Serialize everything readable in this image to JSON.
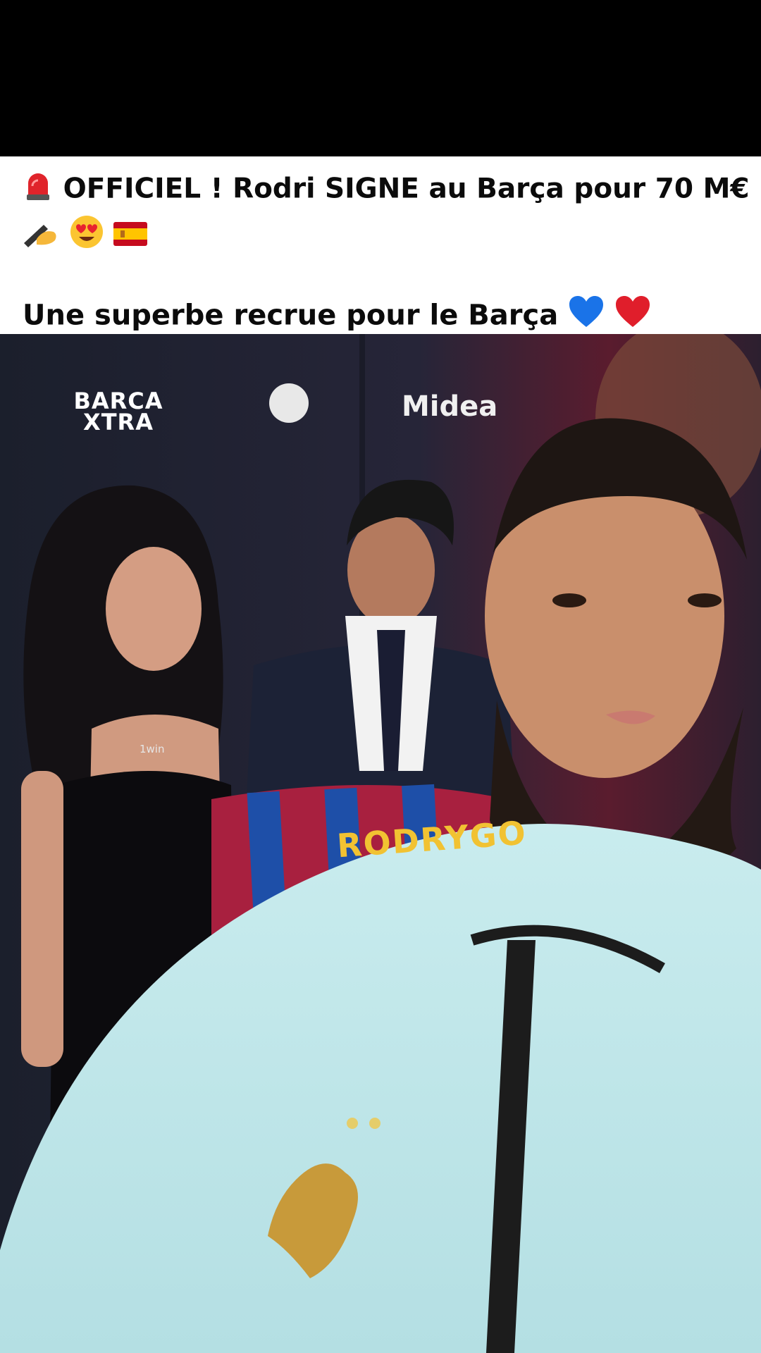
{
  "caption": {
    "headline": "OFFICIEL ! Rodri SIGNE au Barça pour 70 M€ !",
    "subline": "Une superbe recrue pour le Barça",
    "icons": [
      "police-light-emoji",
      "writing-hand-emoji",
      "heart-eyes-emoji",
      "spain-flag-emoji",
      "blue-heart-emoji",
      "red-heart-emoji"
    ]
  },
  "media": {
    "barca_logo": "BARCA\nXTRA",
    "midea_logo": "Midea",
    "jersey_name": "RODRYGO",
    "necklace": "1win"
  }
}
